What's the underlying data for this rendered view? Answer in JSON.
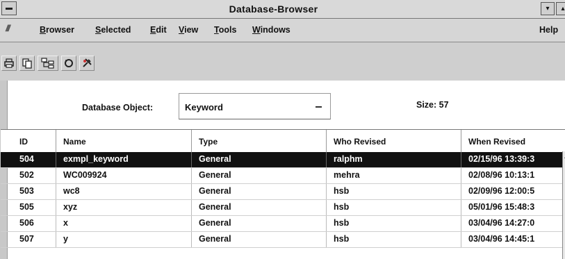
{
  "window": {
    "title": "Database-Browser",
    "minimize_glyph": "▾",
    "maximize_glyph": "▴"
  },
  "menubar": {
    "items": [
      {
        "label": "Browser",
        "mnemonic": "B"
      },
      {
        "label": "Selected",
        "mnemonic": "S"
      },
      {
        "label": "Edit",
        "mnemonic": "E"
      },
      {
        "label": "View",
        "mnemonic": "V"
      },
      {
        "label": "Tools",
        "mnemonic": "T"
      },
      {
        "label": "Windows",
        "mnemonic": "W"
      }
    ],
    "help": "Help"
  },
  "toolbar": {
    "icons": [
      "print-icon",
      "copy-icon",
      "tree-icon",
      "refresh-icon",
      "tools-icon"
    ]
  },
  "object_panel": {
    "label": "Database Object:",
    "selected": "Keyword",
    "size_label": "Size: 57"
  },
  "table": {
    "columns": [
      "ID",
      "Name",
      "Type",
      "Who Revised",
      "When Revised"
    ],
    "rows": [
      {
        "id": "504",
        "name": "exmpl_keyword",
        "type": "General",
        "who": "ralphm",
        "when": "02/15/96 13:39:3",
        "selected": true
      },
      {
        "id": "502",
        "name": "WC009924",
        "type": "General",
        "who": "mehra",
        "when": "02/08/96 10:13:1"
      },
      {
        "id": "503",
        "name": "wc8",
        "type": "General",
        "who": "hsb",
        "when": "02/09/96 12:00:5"
      },
      {
        "id": "505",
        "name": "xyz",
        "type": "General",
        "who": "hsb",
        "when": "05/01/96 15:48:3"
      },
      {
        "id": "506",
        "name": "x",
        "type": "General",
        "who": "hsb",
        "when": "03/04/96 14:27:0"
      },
      {
        "id": "507",
        "name": "y",
        "type": "General",
        "who": "hsb",
        "when": "03/04/96 14:45:1"
      }
    ]
  }
}
